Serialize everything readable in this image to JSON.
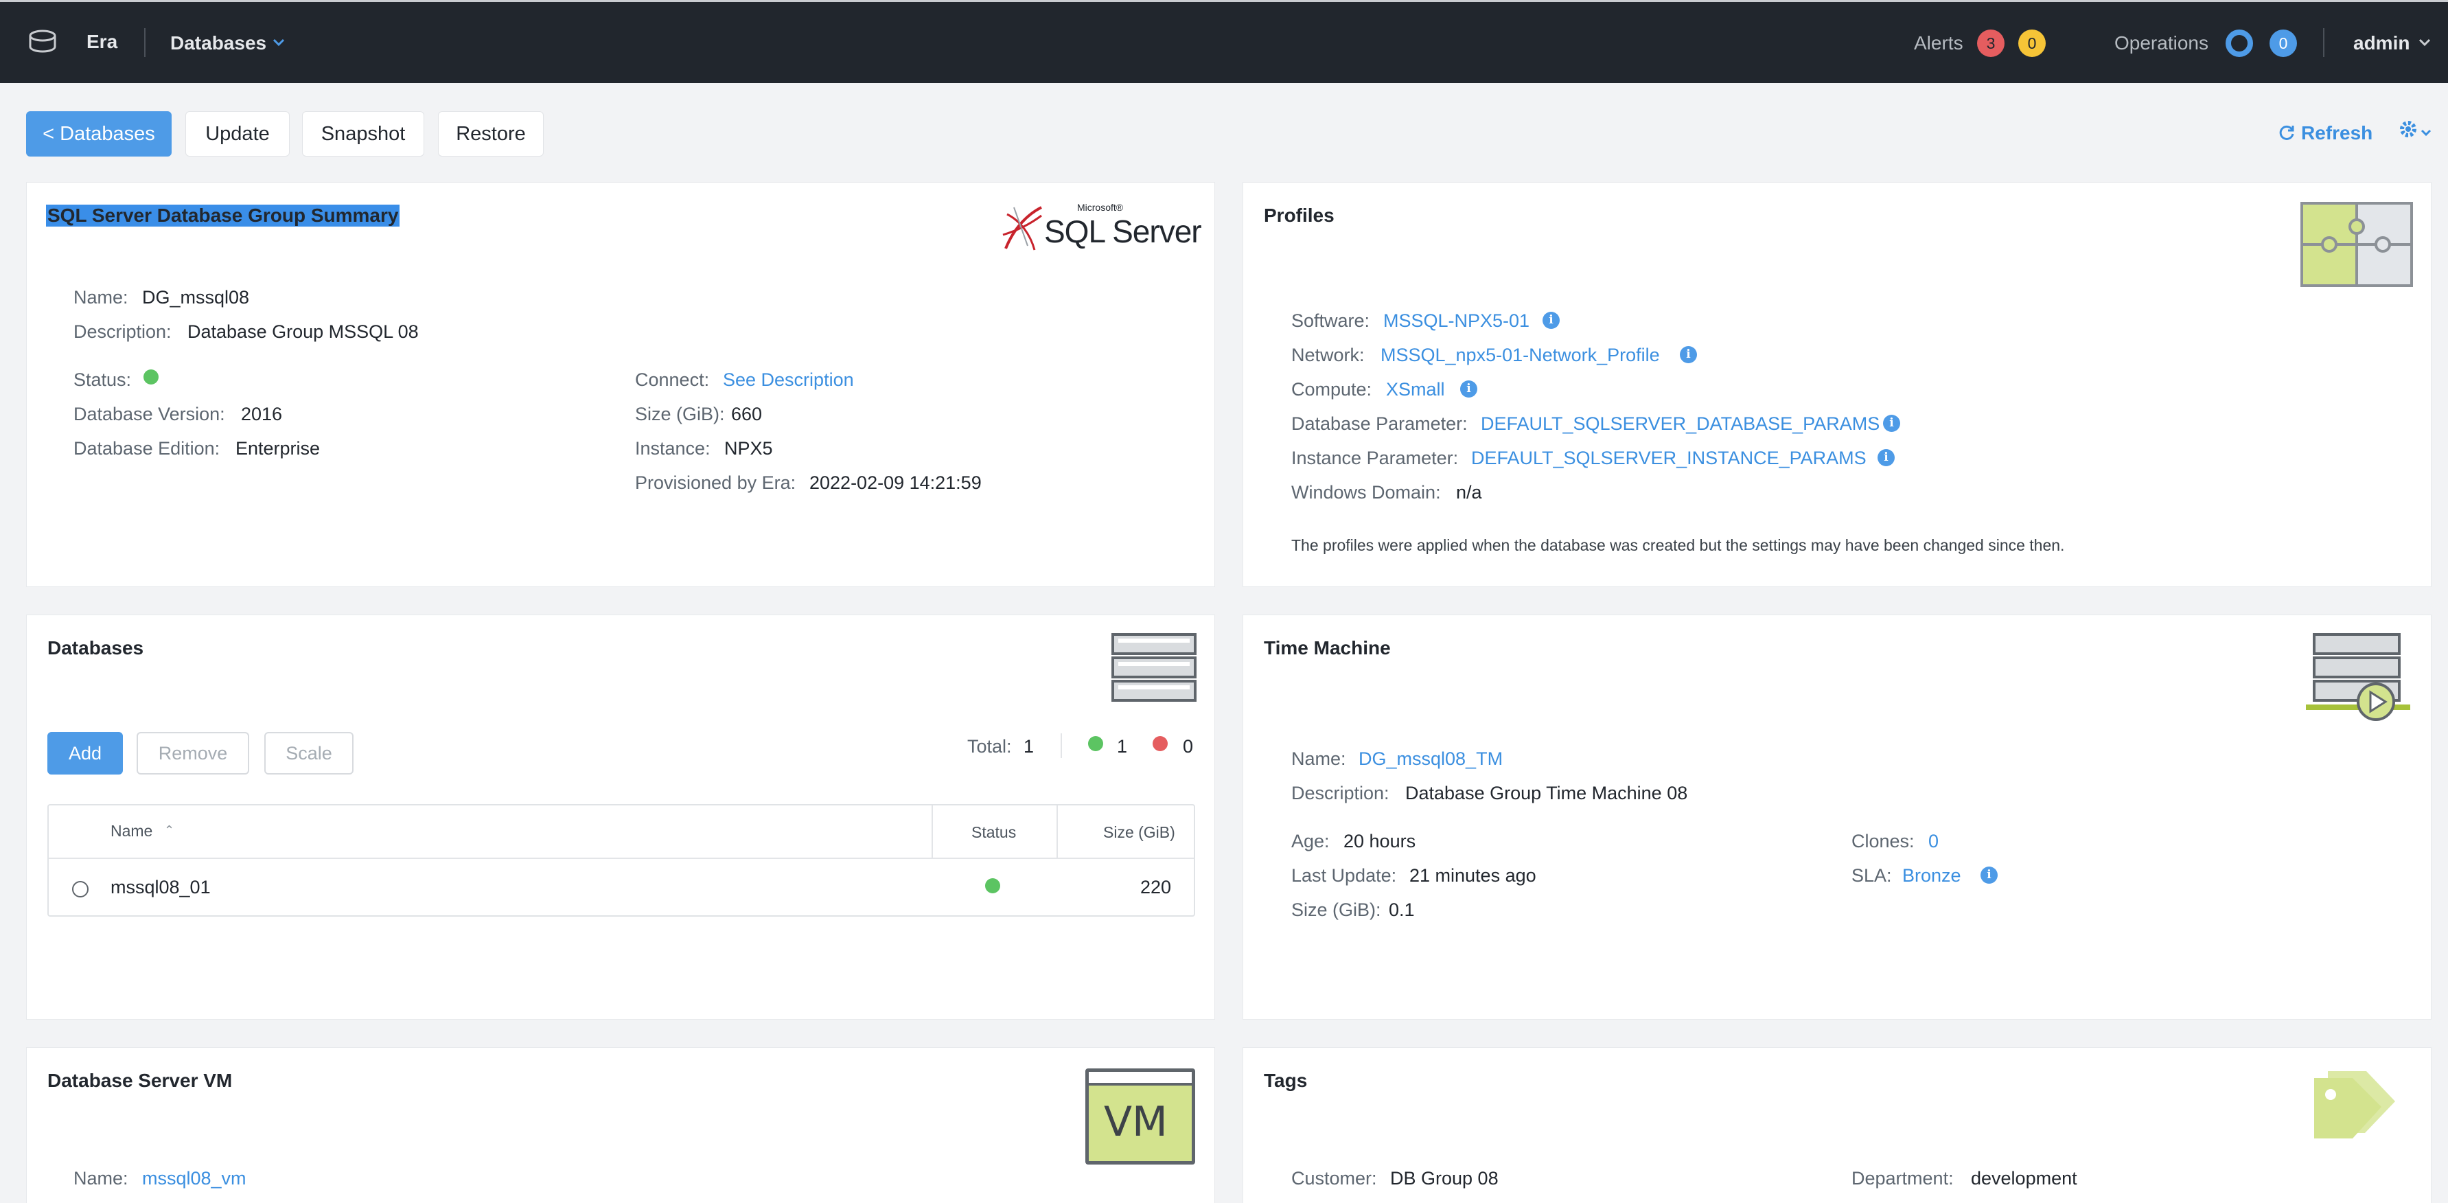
{
  "topbar": {
    "app_name": "Era",
    "nav_label": "Databases",
    "alerts_label": "Alerts",
    "alerts_red": "3",
    "alerts_yellow": "0",
    "operations_label": "Operations",
    "operations_count": "0",
    "user": "admin"
  },
  "toolbar": {
    "back_label": "< Databases",
    "update_label": "Update",
    "snapshot_label": "Snapshot",
    "restore_label": "Restore",
    "refresh_label": "Refresh"
  },
  "summary": {
    "title": "SQL Server Database Group Summary",
    "logo_small": "Microsoft®",
    "logo_big": "SQL Server",
    "name_label": "Name:",
    "name": "DG_mssql08",
    "description_label": "Description:",
    "description": "Database Group MSSQL 08",
    "status_label": "Status:",
    "version_label": "Database Version:",
    "version": "2016",
    "edition_label": "Database Edition:",
    "edition": "Enterprise",
    "connect_label": "Connect:",
    "connect": "See Description",
    "size_label": "Size (GiB):",
    "size": "660",
    "instance_label": "Instance:",
    "instance": "NPX5",
    "provisioned_label": "Provisioned by Era:",
    "provisioned": "2022-02-09 14:21:59"
  },
  "profiles": {
    "title": "Profiles",
    "software_label": "Software:",
    "software": "MSSQL-NPX5-01",
    "network_label": "Network:",
    "network": "MSSQL_npx5-01-Network_Profile",
    "compute_label": "Compute:",
    "compute": "XSmall",
    "db_param_label": "Database Parameter:",
    "db_param": "DEFAULT_SQLSERVER_DATABASE_PARAMS",
    "inst_param_label": "Instance Parameter:",
    "inst_param": "DEFAULT_SQLSERVER_INSTANCE_PARAMS",
    "domain_label": "Windows Domain:",
    "domain": "n/a",
    "note": "The profiles were applied when the database was created but the settings may have been changed since then."
  },
  "databases": {
    "title": "Databases",
    "add_label": "Add",
    "remove_label": "Remove",
    "scale_label": "Scale",
    "total_label": "Total:",
    "total": "1",
    "up_count": "1",
    "down_count": "0",
    "columns": [
      "Name",
      "Status",
      "Size (GiB)"
    ],
    "sort_indicator": "⌃",
    "rows": [
      {
        "name": "mssql08_01",
        "size": "220"
      }
    ]
  },
  "time_machine": {
    "title": "Time Machine",
    "name_label": "Name:",
    "name": "DG_mssql08_TM",
    "description_label": "Description:",
    "description": "Database Group Time Machine 08",
    "age_label": "Age:",
    "age": "20 hours",
    "last_update_label": "Last Update:",
    "last_update": "21 minutes ago",
    "size_label": "Size (GiB):",
    "size": "0.1",
    "clones_label": "Clones:",
    "clones": "0",
    "sla_label": "SLA:",
    "sla": "Bronze"
  },
  "server_vm": {
    "title": "Database Server VM",
    "vm_icon_text": "VM",
    "name_label": "Name:",
    "name": "mssql08_vm"
  },
  "tags": {
    "title": "Tags",
    "customer_label": "Customer:",
    "customer": "DB Group 08",
    "department_label": "Department:",
    "department": "development"
  }
}
